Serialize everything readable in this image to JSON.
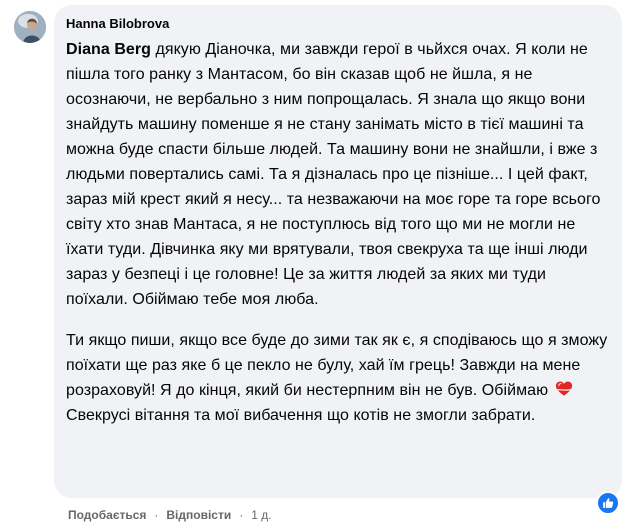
{
  "comment": {
    "author": "Hanna Bilobrova",
    "mention": "Diana Berg",
    "paragraph1_after_mention": " дякую Діаночка, ми завжди герої в чьйхся очах. Я коли не пішла того ранку з Мантасом, бо він сказав щоб не йшла, я не осознаючи, не вербально з ним попрощалась. Я знала що якщо вони знайдуть машину поменше я не стану занімать місто в тієї машині та можна буде спасти більше людей. Та машину вони не знайшли, і вже з людьми повертались самі. Та я дізналась про це пізніше... І цей факт, зараз мій крест який я несу... та незважаючи на моє горе та горе всього світу хто знав Мантаса, я не поступлюсь від того що ми не могли не їхати туди. Дівчинка яку ми врятували, твоя свекруха та ще інші люди зараз у безпеці і це головне! Це за життя людей за яких ми туди поїхали. Обіймаю тебе моя люба.",
    "paragraph2_before_emoji": "Ти якщо пиши, якщо все буде до зими так як є, я сподіваюсь що я зможу поїхати ще раз яке б це пекло не булу, хай їм грець! Завжди на мене розраховуй! Я до кінця, який би нестерпним він не був. Обіймаю",
    "paragraph2_after_emoji": " Свекрусі вітання та мої вибачення що котів не змогли забрати.",
    "emoji_icon": "red-heart-icon",
    "reaction_icon": "thumbs-up-icon"
  },
  "actions": {
    "like_label": "Подобається",
    "reply_label": "Відповісти",
    "separator": "·",
    "time": "1 д."
  },
  "colors": {
    "bubble_bg": "#f0f2f5",
    "text": "#050505",
    "muted": "#65676b",
    "like_blue": "#1877f2",
    "heart_red": "#e02828"
  }
}
